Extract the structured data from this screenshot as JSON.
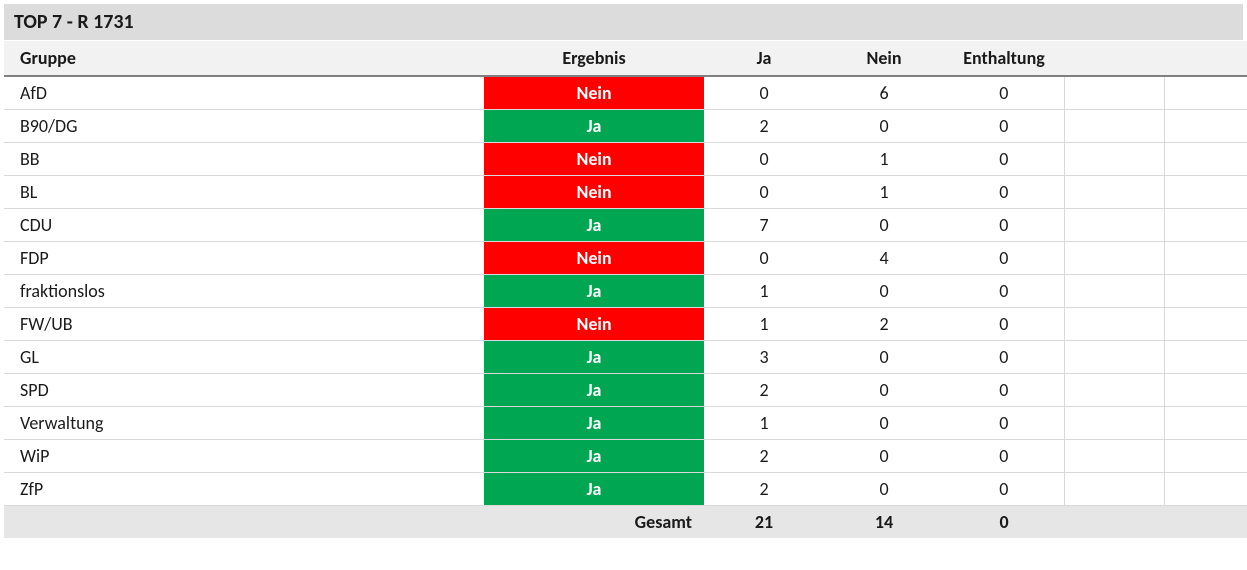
{
  "title": "TOP 7 - R 1731",
  "headers": {
    "group": "Gruppe",
    "result": "Ergebnis",
    "yes": "Ja",
    "no": "Nein",
    "abstain": "Enthaltung",
    "extra1": "",
    "extra2": ""
  },
  "resultLabels": {
    "yes": "Ja",
    "no": "Nein"
  },
  "rows": [
    {
      "group": "AfD",
      "result": "no",
      "yes": 0,
      "no": 6,
      "abstain": 0
    },
    {
      "group": "B90/DG",
      "result": "yes",
      "yes": 2,
      "no": 0,
      "abstain": 0
    },
    {
      "group": "BB",
      "result": "no",
      "yes": 0,
      "no": 1,
      "abstain": 0
    },
    {
      "group": "BL",
      "result": "no",
      "yes": 0,
      "no": 1,
      "abstain": 0
    },
    {
      "group": "CDU",
      "result": "yes",
      "yes": 7,
      "no": 0,
      "abstain": 0
    },
    {
      "group": "FDP",
      "result": "no",
      "yes": 0,
      "no": 4,
      "abstain": 0
    },
    {
      "group": "fraktionslos",
      "result": "yes",
      "yes": 1,
      "no": 0,
      "abstain": 0
    },
    {
      "group": "FW/UB",
      "result": "no",
      "yes": 1,
      "no": 2,
      "abstain": 0
    },
    {
      "group": "GL",
      "result": "yes",
      "yes": 3,
      "no": 0,
      "abstain": 0
    },
    {
      "group": "SPD",
      "result": "yes",
      "yes": 2,
      "no": 0,
      "abstain": 0
    },
    {
      "group": "Verwaltung",
      "result": "yes",
      "yes": 1,
      "no": 0,
      "abstain": 0
    },
    {
      "group": "WiP",
      "result": "yes",
      "yes": 2,
      "no": 0,
      "abstain": 0
    },
    {
      "group": "ZfP",
      "result": "yes",
      "yes": 2,
      "no": 0,
      "abstain": 0
    }
  ],
  "total": {
    "label": "Gesamt",
    "yes": 21,
    "no": 14,
    "abstain": 0
  }
}
